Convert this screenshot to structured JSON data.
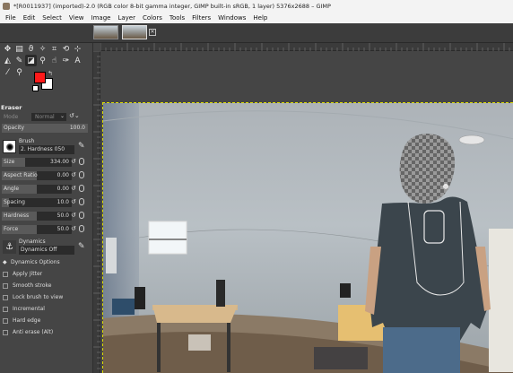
{
  "title": "*[R0011937] (imported)-2.0 (RGB color 8-bit gamma integer, GIMP built-in sRGB, 1 layer) 5376x2688 – GIMP",
  "menu": [
    "File",
    "Edit",
    "Select",
    "View",
    "Image",
    "Layer",
    "Colors",
    "Tools",
    "Filters",
    "Windows",
    "Help"
  ],
  "colors": {
    "foreground": "#ff1a1a",
    "background": "#ffffff"
  },
  "tool_options": {
    "title": "Eraser",
    "mode_label": "Mode",
    "mode_value": "Normal",
    "opacity": {
      "label": "Opacity",
      "value": "100.0",
      "percent": 100
    },
    "brush_label": "Brush",
    "brush_name": "2. Hardness 050",
    "size": {
      "label": "Size",
      "value": "334.00",
      "percent": 33
    },
    "aspect_ratio": {
      "label": "Aspect Ratio",
      "value": "0.00",
      "percent": 50
    },
    "angle": {
      "label": "Angle",
      "value": "0.00",
      "percent": 50
    },
    "spacing": {
      "label": "Spacing",
      "value": "10.0",
      "percent": 10
    },
    "hardness": {
      "label": "Hardness",
      "value": "50.0",
      "percent": 50
    },
    "force": {
      "label": "Force",
      "value": "50.0",
      "percent": 50
    },
    "dynamics_label": "Dynamics",
    "dynamics_name": "Dynamics Off",
    "options": [
      "Dynamics Options",
      "Apply Jitter",
      "Smooth stroke",
      "Lock brush to view",
      "Incremental",
      "Hard edge",
      "Anti erase  (Alt)"
    ]
  },
  "icons": {
    "tools": [
      "move-icon",
      "align-icon",
      "free-select-icon",
      "fuzzy-select-icon",
      "crop-icon",
      "rotate-icon",
      "warp-icon",
      "cage-icon",
      "bucket-fill-icon",
      "paintbrush-icon",
      "eraser-icon",
      "clone-icon",
      "smudge-icon",
      "path-icon",
      "text-icon",
      "color-picker-icon",
      "zoom-icon"
    ]
  }
}
